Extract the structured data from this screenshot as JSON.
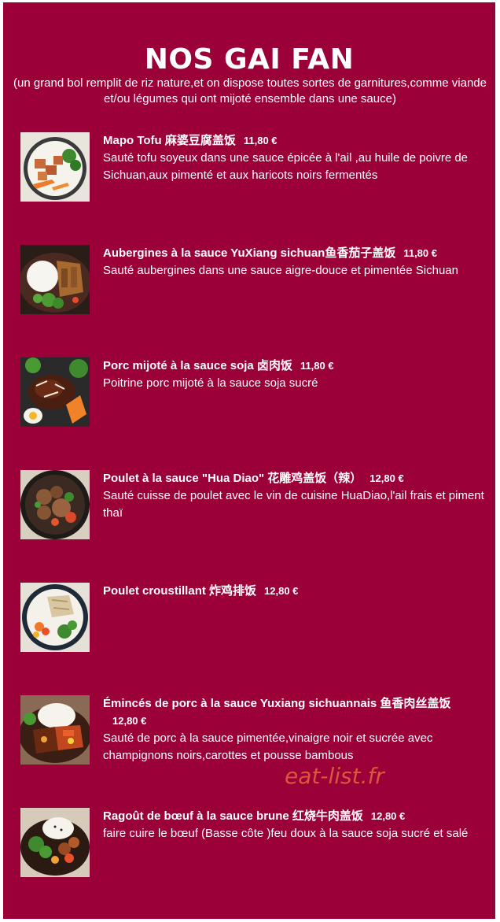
{
  "header": {
    "title": "NOS GAI FAN",
    "subtitle": "(un grand bol remplit de riz nature,et on dispose toutes sortes de garnitures,comme viande et/ou légumes qui ont mijoté ensemble dans une sauce)"
  },
  "dishes": [
    {
      "name": "Mapo Tofu 麻婆豆腐盖饭",
      "price": "11,80 €",
      "description": "Sauté tofu soyeux dans une sauce épicée à l'ail ,au huile de poivre de Sichuan,aux pimenté et aux haricots noirs fermentés",
      "image": "mapo-tofu-bowl"
    },
    {
      "name": "Aubergines à la sauce YuXiang sichuan鱼香茄子盖饭",
      "price": "11,80 €",
      "description": "Sauté aubergines dans une sauce aigre-douce et pimentée Sichuan",
      "image": "eggplant-rice-plate"
    },
    {
      "name": "Porc mijoté à la sauce soja 卤肉饭",
      "price": "11,80 €",
      "description": "Poitrine porc mijoté à la sauce soja sucré",
      "image": "braised-pork-rice"
    },
    {
      "name": "Poulet à la sauce \"Hua Diao\" 花雕鸡盖饭（辣）",
      "price": "12,80 €",
      "description": "Sauté cuisse de poulet avec le vin de cuisine HuaDiao,l'ail frais et piment thaï",
      "image": "huadiao-chicken-plate"
    },
    {
      "name": "Poulet croustillant 炸鸡排饭",
      "price": "12,80 €",
      "description": "",
      "image": "crispy-chicken-bowl"
    },
    {
      "name": "Émincés de porc à la sauce Yuxiang sichuannais 鱼香肉丝盖饭",
      "price": "12,80 €",
      "description": "Sauté de porc à la sauce pimentée,vinaigre noir et sucrée avec champignons noirs,carottes et pousse bambous",
      "image": "shredded-pork-plate"
    },
    {
      "name": "Ragoût de bœuf à la sauce brune 红烧牛肉盖饭",
      "price": "12,80 €",
      "description": "faire cuire le bœuf (Basse côte )feu doux à la sauce soja sucré et salé",
      "image": "braised-beef-plate"
    }
  ],
  "watermark": "eat-list.fr",
  "colors": {
    "background": "#9c0038",
    "text": "#ffffff",
    "watermark": "#d9583a"
  }
}
